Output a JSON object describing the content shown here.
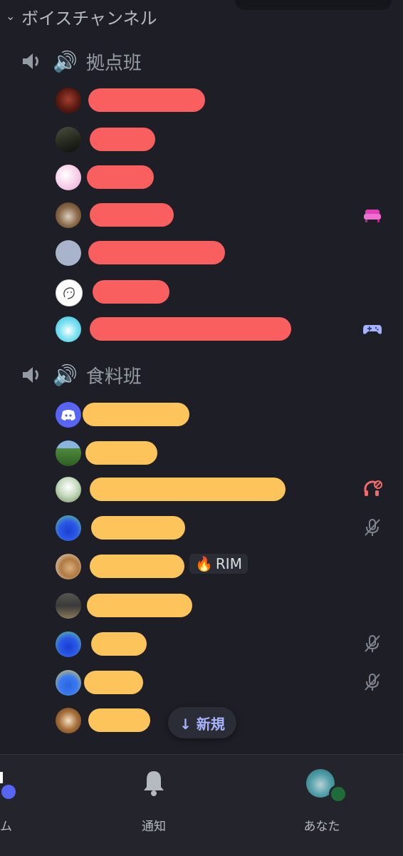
{
  "category": {
    "label": "ボイスチャンネル"
  },
  "channels": [
    {
      "name": "拠点班",
      "bar_color": "#fa5f5f",
      "members": [
        {
          "avatar": "dark-red",
          "status": ""
        },
        {
          "avatar": "dark-forest",
          "status": ""
        },
        {
          "avatar": "pink-pastel",
          "status": ""
        },
        {
          "avatar": "brown-dog",
          "status": "activity-sofa-icon"
        },
        {
          "avatar": "gray-blue",
          "status": ""
        },
        {
          "avatar": "white-sketch",
          "status": ""
        },
        {
          "avatar": "cyan-character",
          "status": "game-controller-icon"
        }
      ]
    },
    {
      "name": "食料班",
      "bar_color": "#fec45c",
      "members": [
        {
          "avatar": "discord-blurple",
          "status": ""
        },
        {
          "avatar": "green-field",
          "status": ""
        },
        {
          "avatar": "green-anime",
          "status": "deafened-icon"
        },
        {
          "avatar": "blue-penguin",
          "status": "muted-mic-icon"
        },
        {
          "avatar": "fox-cat",
          "status": "",
          "badge": "RIM"
        },
        {
          "avatar": "street-scene",
          "status": ""
        },
        {
          "avatar": "blue-penguin",
          "status": "muted-mic-icon"
        },
        {
          "avatar": "blue-monster-yellow",
          "status": "muted-mic-icon"
        },
        {
          "avatar": "anime-girl",
          "status": ""
        }
      ]
    }
  ],
  "new_pill": {
    "label": "↓ 新規"
  },
  "nav": {
    "left_label": "ム",
    "notifications_label": "通知",
    "you_label": "あなた"
  },
  "colors": {
    "background": "#1e1f26",
    "redacted_red": "#fa5f5f",
    "redacted_yellow": "#fec45c",
    "accent_blurple": "#5865f2"
  }
}
